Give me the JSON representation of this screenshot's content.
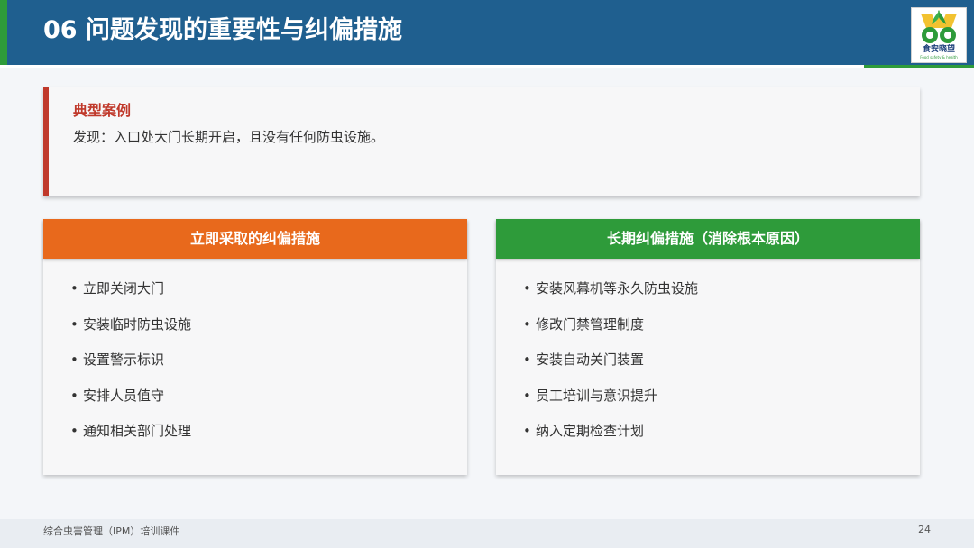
{
  "header": {
    "title": "06  问题发现的重要性与纠偏措施",
    "logo": {
      "icon": "food-safety-logo",
      "caption": "食安晓望",
      "subcaption": "Food safety & health"
    }
  },
  "case": {
    "title": "典型案例",
    "description": "发现：入口处大门长期开启，且没有任何防虫设施。"
  },
  "panels": {
    "immediate": {
      "title": "立即采取的纠偏措施",
      "items": [
        "立即关闭大门",
        "安装临时防虫设施",
        "设置警示标识",
        "安排人员值守",
        "通知相关部门处理"
      ]
    },
    "long_term": {
      "title": "长期纠偏措施（消除根本原因）",
      "items": [
        "安装风幕机等永久防虫设施",
        "修改门禁管理制度",
        "安装自动关门装置",
        "员工培训与意识提升",
        "纳入定期检查计划"
      ]
    }
  },
  "footer": {
    "course": "综合虫害管理（IPM）培训课件",
    "page": "24"
  },
  "colors": {
    "header_bg": "#1f5f8f",
    "accent_green": "#2e9b3a",
    "accent_orange": "#e8691c",
    "accent_red": "#c0392b"
  }
}
